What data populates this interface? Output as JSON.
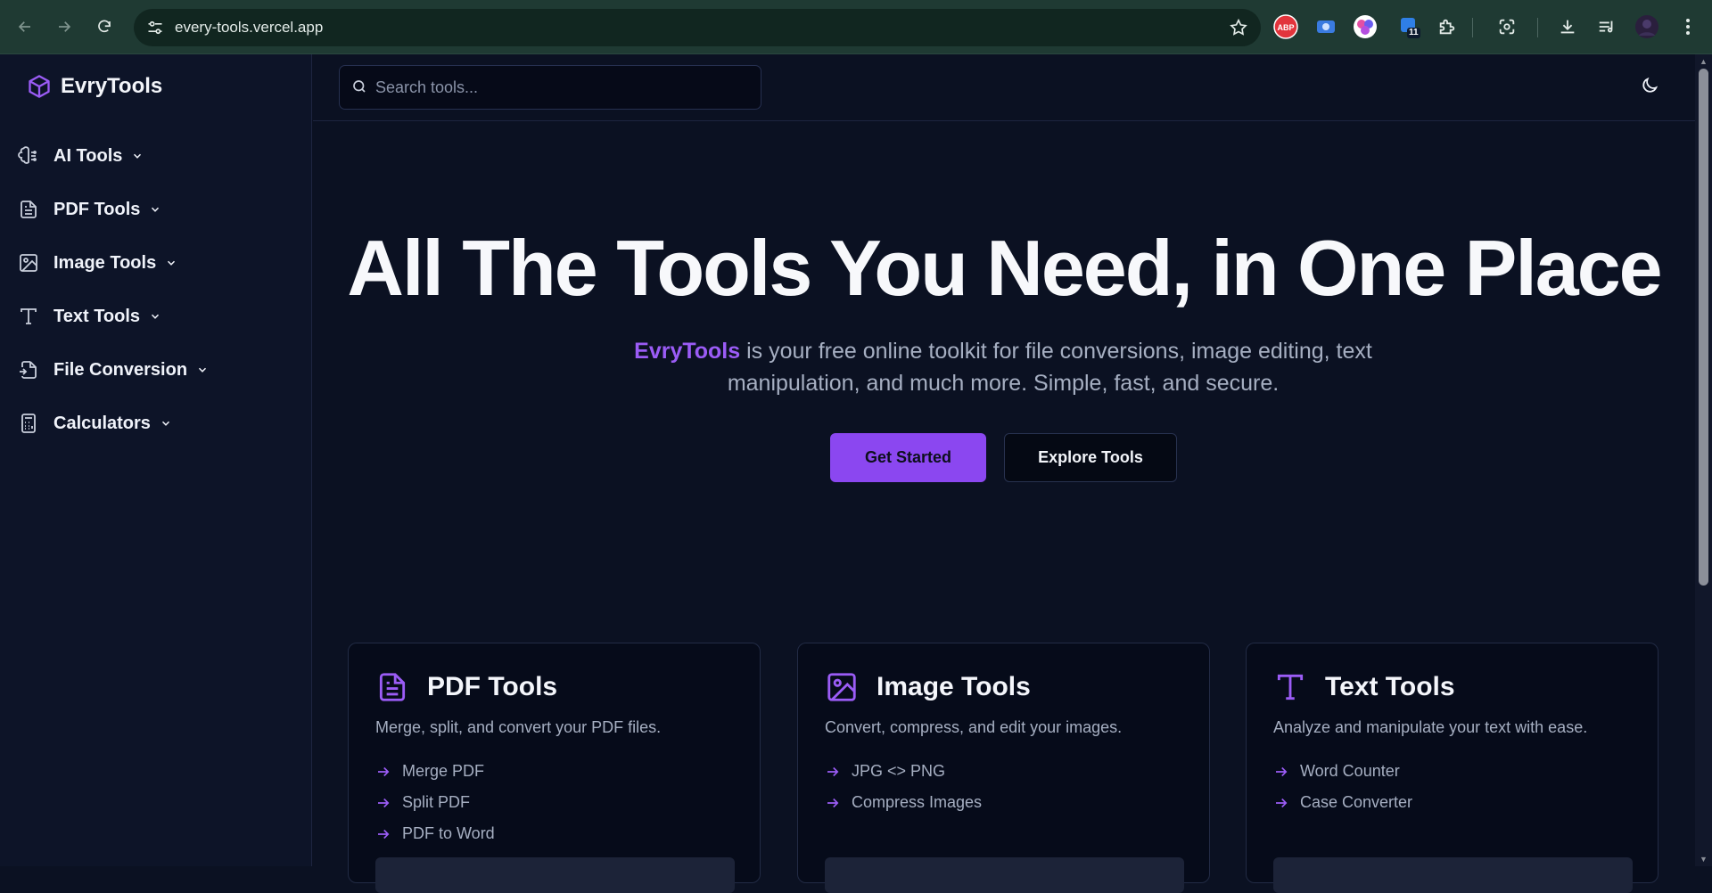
{
  "browser": {
    "url": "every-tools.vercel.app",
    "extension_badge": "11"
  },
  "sidebar": {
    "brand": "EvryTools",
    "items": [
      {
        "label": "AI Tools",
        "icon": "brain-icon"
      },
      {
        "label": "PDF Tools",
        "icon": "file-text-icon"
      },
      {
        "label": "Image Tools",
        "icon": "image-icon"
      },
      {
        "label": "Text Tools",
        "icon": "type-icon"
      },
      {
        "label": "File Conversion",
        "icon": "file-convert-icon"
      },
      {
        "label": "Calculators",
        "icon": "calculator-icon"
      }
    ]
  },
  "search": {
    "placeholder": "Search tools..."
  },
  "hero": {
    "title": "All The Tools You Need, in One Place",
    "brand_highlight": "EvryTools",
    "subtitle": " is your free online toolkit for file conversions, image editing, text manipulation, and much more. Simple, fast, and secure.",
    "primary_button": "Get Started",
    "secondary_button": "Explore Tools"
  },
  "cards": [
    {
      "title": "PDF Tools",
      "description": "Merge, split, and convert your PDF files.",
      "items": [
        "Merge PDF",
        "Split PDF",
        "PDF to Word"
      ]
    },
    {
      "title": "Image Tools",
      "description": "Convert, compress, and edit your images.",
      "items": [
        "JPG <> PNG",
        "Compress Images"
      ]
    },
    {
      "title": "Text Tools",
      "description": "Analyze and manipulate your text with ease.",
      "items": [
        "Word Counter",
        "Case Converter"
      ]
    }
  ],
  "colors": {
    "accent": "#8b47f0",
    "background": "#0b1122",
    "sidebar": "#0d1428",
    "chrome": "#1f3a33"
  }
}
